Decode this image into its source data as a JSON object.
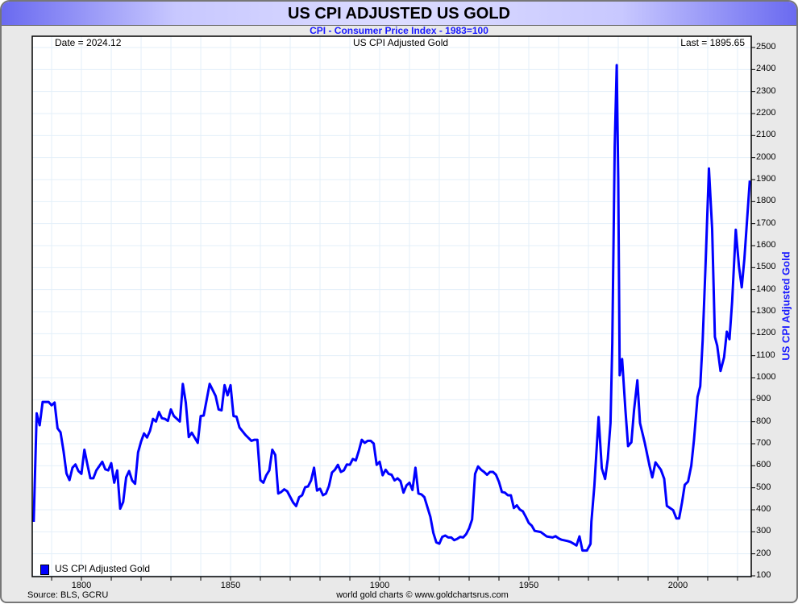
{
  "header": {
    "title": "US CPI ADJUSTED US GOLD",
    "subtitle": "CPI - Consumer Price Index - 1983=100"
  },
  "plot": {
    "date_label": "Date = 2024.12",
    "series_title": "US CPI Adjusted Gold",
    "last_label": "Last = 1895.65"
  },
  "legend": {
    "label": "US CPI Adjusted Gold"
  },
  "footer": {
    "source": "Source: BLS, GCRU",
    "credit": "world gold charts © www.goldchartsrus.com"
  },
  "colors": {
    "line": "#0000ff",
    "grid": "#e3eff9",
    "accent": "#1a1aff"
  },
  "chart_data": {
    "type": "line",
    "title": "US CPI ADJUSTED US GOLD",
    "subtitle": "CPI - Consumer Price Index - 1983=100",
    "xlabel": "",
    "ylabel": "US CPI Adjusted Gold",
    "xlim": [
      1783.5,
      2024.6
    ],
    "ylim": [
      100,
      2500
    ],
    "xticks": [
      1800,
      1850,
      1900,
      1950,
      2000
    ],
    "yticks": [
      100,
      200,
      300,
      400,
      500,
      600,
      700,
      800,
      900,
      1000,
      1100,
      1200,
      1300,
      1400,
      1500,
      1600,
      1700,
      1800,
      1900,
      2000,
      2100,
      2200,
      2300,
      2400,
      2500
    ],
    "grid": true,
    "legend_position": "bottom-left",
    "series": [
      {
        "name": "US CPI Adjusted Gold",
        "x": [
          1784,
          1785,
          1786,
          1787,
          1789,
          1790,
          1791,
          1792,
          1793,
          1794,
          1795,
          1796,
          1797,
          1798,
          1799,
          1800,
          1801,
          1802,
          1803,
          1804,
          1805,
          1807,
          1808,
          1809,
          1810,
          1811,
          1812,
          1813,
          1814,
          1815,
          1816,
          1817,
          1818,
          1819,
          1820,
          1821,
          1822,
          1823,
          1824,
          1825,
          1826,
          1827,
          1828,
          1829,
          1830,
          1831,
          1833,
          1834,
          1835,
          1836,
          1837,
          1839,
          1840,
          1841,
          1843,
          1845,
          1846,
          1847,
          1848,
          1849,
          1850,
          1851,
          1852,
          1853,
          1855,
          1857,
          1858,
          1859,
          1860,
          1861,
          1862,
          1863,
          1864,
          1865,
          1866,
          1867,
          1868,
          1869,
          1871,
          1872,
          1873,
          1874,
          1875,
          1876,
          1877,
          1878,
          1879,
          1880,
          1881,
          1882,
          1883,
          1884,
          1885,
          1886,
          1887,
          1888,
          1889,
          1890,
          1891,
          1892,
          1893,
          1894,
          1895,
          1896,
          1897,
          1898,
          1899,
          1900,
          1901,
          1902,
          1903,
          1904,
          1905,
          1906,
          1907,
          1908,
          1909,
          1910,
          1911,
          1912,
          1913,
          1914,
          1915,
          1917,
          1918,
          1919,
          1920,
          1921,
          1922,
          1923,
          1924,
          1925,
          1926,
          1927,
          1928,
          1929,
          1930,
          1931,
          1932,
          1933,
          1934,
          1935,
          1936,
          1937,
          1938,
          1939,
          1940,
          1941,
          1942,
          1943,
          1944,
          1945,
          1946,
          1947,
          1948,
          1949,
          1950,
          1951,
          1952,
          1954,
          1955,
          1956,
          1958,
          1959,
          1960,
          1961,
          1963,
          1964,
          1965,
          1966,
          1967,
          1968,
          1969.5,
          1970.7,
          1971,
          1972,
          1973.4,
          1974.5,
          1975.6,
          1976.5,
          1977.4,
          1978,
          1978.8,
          1979.5,
          1980,
          1980.5,
          1981.3,
          1982.4,
          1983.3,
          1984.4,
          1985.3,
          1986.4,
          1987.3,
          1988.9,
          1990.5,
          1991.4,
          1992.5,
          1994.3,
          1995.4,
          1996.3,
          1998.4,
          1999.5,
          2000.4,
          2001.4,
          2002.3,
          2003.4,
          2004.5,
          2005.4,
          2006.6,
          2007.5,
          2008.3,
          2009.2,
          2010.4,
          2011.5,
          2012.4,
          2013.2,
          2014.3,
          2015.5,
          2016.4,
          2017.3,
          2018.2,
          2019.4,
          2020.5,
          2021.4,
          2022.3,
          2024.12
        ],
        "y": [
          345,
          838,
          784,
          890,
          890,
          875,
          887,
          770,
          752,
          667,
          565,
          535,
          591,
          606,
          576,
          563,
          673,
          606,
          543,
          543,
          579,
          618,
          584,
          579,
          612,
          523,
          579,
          405,
          435,
          547,
          576,
          533,
          518,
          661,
          710,
          747,
          728,
          759,
          813,
          801,
          844,
          816,
          813,
          804,
          856,
          826,
          801,
          972,
          887,
          730,
          750,
          704,
          826,
          828,
          972,
          917,
          856,
          852,
          966,
          920,
          966,
          826,
          823,
          774,
          740,
          713,
          718,
          718,
          535,
          523,
          557,
          579,
          673,
          649,
          474,
          481,
          493,
          484,
          433,
          417,
          457,
          466,
          502,
          506,
          533,
          591,
          487,
          496,
          466,
          474,
          508,
          569,
          582,
          604,
          572,
          579,
          606,
          604,
          631,
          624,
          667,
          718,
          704,
          713,
          713,
          701,
          604,
          618,
          557,
          582,
          563,
          559,
          533,
          543,
          530,
          478,
          511,
          523,
          490,
          591,
          474,
          470,
          457,
          368,
          295,
          252,
          246,
          277,
          283,
          274,
          274,
          262,
          268,
          277,
          274,
          289,
          316,
          356,
          563,
          597,
          582,
          572,
          559,
          572,
          572,
          559,
          527,
          481,
          478,
          466,
          466,
          408,
          420,
          401,
          393,
          368,
          340,
          328,
          304,
          299,
          289,
          279,
          274,
          280,
          270,
          264,
          258,
          254,
          246,
          238,
          279,
          215,
          215,
          245,
          346,
          510,
          821,
          588,
          540,
          630,
          794,
          1154,
          2049,
          2420,
          1900,
          1011,
          1085,
          853,
          689,
          707,
          853,
          988,
          794,
          704,
          600,
          547,
          615,
          582,
          541,
          418,
          398,
          361,
          361,
          435,
          513,
          528,
          600,
          719,
          913,
          961,
          1167,
          1481,
          1950,
          1675,
          1185,
          1145,
          1030,
          1093,
          1209,
          1175,
          1346,
          1672,
          1504,
          1410,
          1541,
          1895.65
        ]
      }
    ]
  }
}
